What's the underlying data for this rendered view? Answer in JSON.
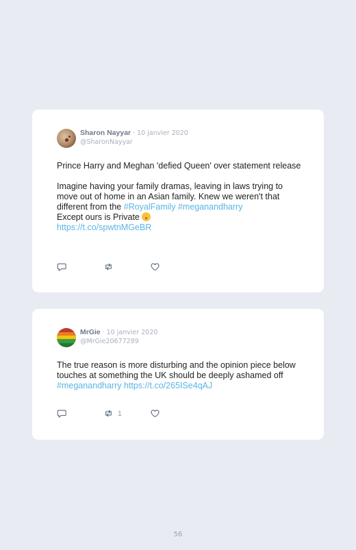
{
  "tweets": [
    {
      "name": "Sharon Nayyar",
      "separator": "·",
      "date": "10 janvier 2020",
      "handle": "@SharonNayyar",
      "line_1": "Prince Harry and Meghan 'defied Queen' over statement release",
      "line_2": "Imagine having your family dramas, leaving in laws trying to move out of home in an Asian family. Knew we weren't that different from the ",
      "hashtag_1": "#RoyalFamily",
      "hashtag_2": "#meganandharry",
      "line_3": "Except ours is Private ",
      "link": "https://t.co/spwtnMGeBR",
      "retweets": ""
    },
    {
      "name": "MrGie",
      "separator": "·",
      "date": "10 janvier 2020",
      "handle": "@MrGie20677289",
      "text": "The true reason is more disturbing and the opinion piece below touches at something the UK should be deeply ashamed off ",
      "hashtag": "#meganandharry",
      "link": "https://t.co/265ISe4qAJ",
      "retweets": "1"
    }
  ],
  "icons": {
    "reply": "reply-icon",
    "retweet": "retweet-icon",
    "like": "heart-icon",
    "emoji": "hushed-face-emoji"
  },
  "colors": {
    "background": "#e8ebf2",
    "card": "#ffffff",
    "link": "#5ab4e5",
    "name": "#6b7a8c",
    "muted": "#a7b0bc"
  },
  "page_number": "56"
}
